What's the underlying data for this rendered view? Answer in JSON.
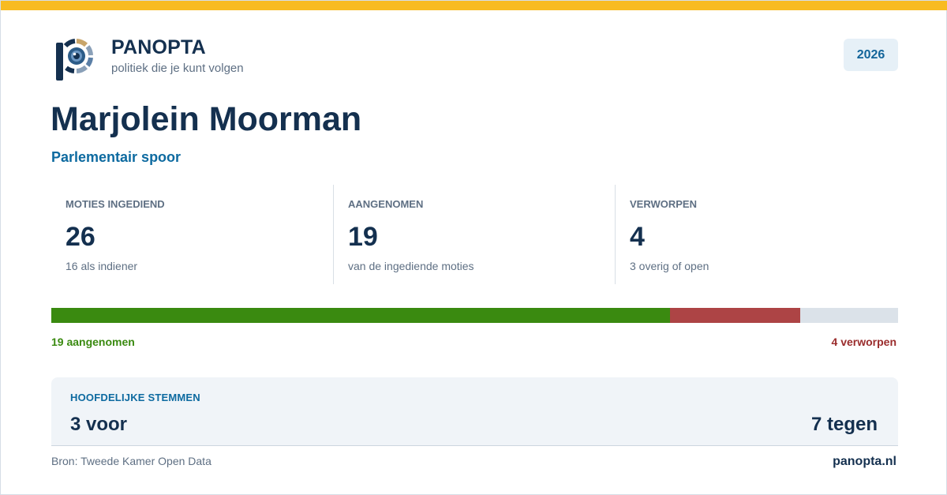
{
  "brand": {
    "name": "PANOPTA",
    "tagline": "politiek die je kunt volgen",
    "logo_icon": "panopta-eye-logo-icon"
  },
  "year_badge": "2026",
  "person": {
    "name": "Marjolein Moorman",
    "subtitle": "Parlementair spoor"
  },
  "stats": [
    {
      "label": "MOTIES INGEDIEND",
      "value": "26",
      "sub": "16 als indiener"
    },
    {
      "label": "AANGENOMEN",
      "value": "19",
      "sub": "van de ingediende moties"
    },
    {
      "label": "VERWORPEN",
      "value": "4",
      "sub": "3 overig of open"
    }
  ],
  "progress": {
    "accepted": 19,
    "rejected": 4,
    "other": 3,
    "total": 26,
    "accepted_label": "19 aangenomen",
    "rejected_label": "4 verworpen"
  },
  "votes": {
    "title": "HOOFDELIJKE STEMMEN",
    "for_label": "3 voor",
    "against_label": "7 tegen"
  },
  "footer": {
    "source": "Bron: Tweede Kamer Open Data",
    "domain": "panopta.nl"
  },
  "colors": {
    "top_bar": "#f8bb21",
    "navy": "#14304f",
    "accent_blue": "#0d6aa0",
    "accepted": "#3a8a10",
    "rejected": "#ad4445",
    "other": "#dbe2e9"
  }
}
